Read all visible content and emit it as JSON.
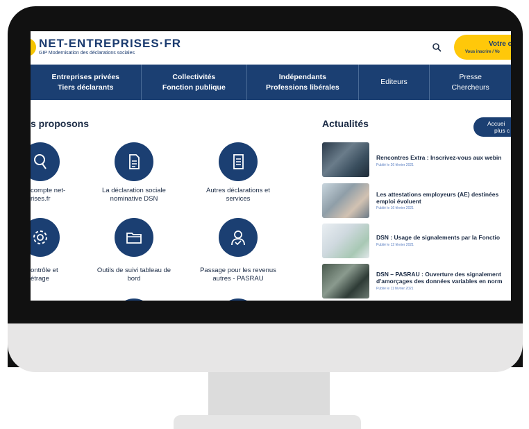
{
  "site": {
    "logo_title": "NET-ENTREPRISES·FR",
    "logo_subtitle": "GIP Modernisation des déclarations sociales",
    "account_title": "Votre co",
    "account_sub": "Vous inscrire / Vo"
  },
  "nav": [
    {
      "line1": "Entreprises privées",
      "line2": "Tiers déclarants",
      "bold": true
    },
    {
      "line1": "Collectivités",
      "line2": "Fonction publique",
      "bold": true
    },
    {
      "line1": "Indépendants",
      "line2": "Professions libérales",
      "bold": true
    },
    {
      "line1": "Editeurs",
      "line2": "",
      "bold": false
    },
    {
      "line1": "Presse",
      "line2": "Chercheurs",
      "bold": false
    }
  ],
  "services": {
    "title": "s proposons",
    "items": [
      {
        "label1": "compte net-",
        "label2": "rises.fr",
        "icon": "user-search-icon"
      },
      {
        "label1": "La déclaration sociale",
        "label2": "nominative DSN",
        "icon": "document-icon"
      },
      {
        "label1": "Autres déclarations et",
        "label2": "services",
        "icon": "document-lines-icon"
      },
      {
        "label1": "ontrôle et",
        "label2": "étrage",
        "icon": "gear-icon"
      },
      {
        "label1": "Outils de suivi tableau de",
        "label2": "bord",
        "icon": "folder-icon"
      },
      {
        "label1": "Passage pour les revenus",
        "label2": "autres - PASRAU",
        "icon": "user-check-icon"
      }
    ]
  },
  "news": {
    "title": "Actualités",
    "button_line1": "Accuei",
    "button_line2": "plus c",
    "items": [
      {
        "title1": "Rencontres Extra : Inscrivez-vous aux webin",
        "title2": "",
        "date": "Publié le 26 février 2021"
      },
      {
        "title1": "Les attestations employeurs (AE) destinées",
        "title2": "emploi évoluent",
        "date": "Publié le 16 février 2021"
      },
      {
        "title1": "DSN : Usage de signalements par la Fonctio",
        "title2": "",
        "date": "Publié le 12 février 2021"
      },
      {
        "title1": "DSN – PASRAU : Ouverture des signalement",
        "title2": "d'amorçages des données variables en norm",
        "date": "Publié le 11 février 2021"
      }
    ]
  },
  "colors": {
    "navy": "#1b3f72",
    "yellow": "#ffc80a",
    "bezel": "#111111"
  }
}
